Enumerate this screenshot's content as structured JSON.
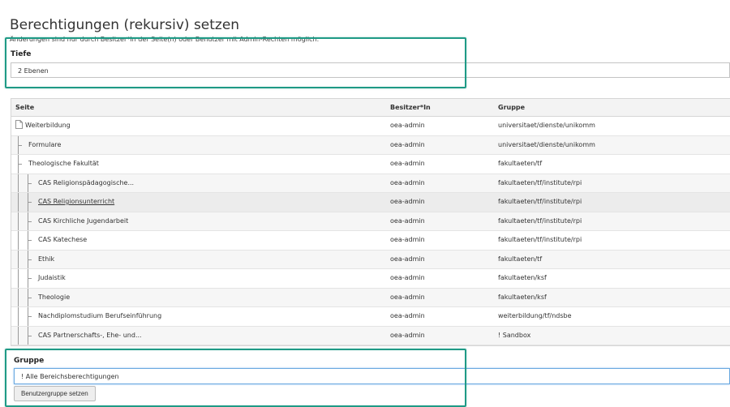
{
  "page": {
    "title": "Berechtigungen (rekursiv) setzen",
    "notice": "Änderungen sind nur durch Besitzer*In der Seite(n) oder Benutzer mit Admin-Rechten möglich."
  },
  "depth": {
    "label": "Tiefe",
    "value": "2 Ebenen"
  },
  "table": {
    "headers": {
      "page": "Seite",
      "owner": "Besitzer*In",
      "group": "Gruppe"
    },
    "rows": [
      {
        "page": "Weiterbildung",
        "owner": "oea-admin",
        "group": "universitaet/dienste/unikomm",
        "level": 0,
        "icon": "page-icon"
      },
      {
        "page": "Formulare",
        "owner": "oea-admin",
        "group": "universitaet/dienste/unikomm",
        "level": 1
      },
      {
        "page": "Theologische Fakultät",
        "owner": "oea-admin",
        "group": "fakultaeten/tf",
        "level": 1
      },
      {
        "page": "CAS Religionspädagogische...",
        "owner": "oea-admin",
        "group": "fakultaeten/tf/institute/rpi",
        "level": 2
      },
      {
        "page": "CAS Religionsunterricht",
        "owner": "oea-admin",
        "group": "fakultaeten/tf/institute/rpi",
        "level": 2
      },
      {
        "page": "CAS Kirchliche Jugendarbeit",
        "owner": "oea-admin",
        "group": "fakultaeten/tf/institute/rpi",
        "level": 2
      },
      {
        "page": "CAS Katechese",
        "owner": "oea-admin",
        "group": "fakultaeten/tf/institute/rpi",
        "level": 2
      },
      {
        "page": "Ethik",
        "owner": "oea-admin",
        "group": "fakultaeten/tf",
        "level": 2
      },
      {
        "page": "Judaistik",
        "owner": "oea-admin",
        "group": "fakultaeten/ksf",
        "level": 2
      },
      {
        "page": "Theologie",
        "owner": "oea-admin",
        "group": "fakultaeten/ksf",
        "level": 2
      },
      {
        "page": "Nachdiplomstudium Berufseinführung",
        "owner": "oea-admin",
        "group": "weiterbildung/tf/ndsbe",
        "level": 2
      },
      {
        "page": "CAS Partnerschafts-, Ehe- und...",
        "owner": "oea-admin",
        "group": "! Sandbox",
        "level": 2
      }
    ]
  },
  "group": {
    "label": "Gruppe",
    "value": "! Alle Bereichsberechtigungen",
    "button_label": "Benutzergruppe setzen"
  },
  "colors": {
    "highlight": "#1f9a86",
    "focus": "#6aa9e0"
  }
}
